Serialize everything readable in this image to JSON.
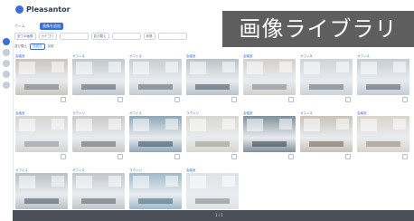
{
  "app": {
    "logo_text": "Pleasantor"
  },
  "banner": {
    "text": "画像ライブラリ"
  },
  "header": {
    "crumb": "ホーム",
    "primary_button": "画像を追加"
  },
  "filters": {
    "chips": [
      "全ての画像",
      "カテゴリ",
      "並び替え",
      "状態"
    ]
  },
  "sort": {
    "label": "並び替え",
    "active": "作成日",
    "other": "名前"
  },
  "images": [
    {
      "title": "会議室",
      "tone": "#c9c4bd",
      "accent": "#6c7076"
    },
    {
      "title": "オフィス",
      "tone": "#bfc6cc",
      "accent": "#4e5a66"
    },
    {
      "title": "オフィス",
      "tone": "#c6ccd1",
      "accent": "#55606b"
    },
    {
      "title": "会議室",
      "tone": "#b9c2c9",
      "accent": "#3f4c58"
    },
    {
      "title": "会議室",
      "tone": "#d3d0cc",
      "accent": "#7b7f86"
    },
    {
      "title": "オフィス",
      "tone": "#cdd3d8",
      "accent": "#5d6873"
    },
    {
      "title": "オフィス",
      "tone": "#c4ccd4",
      "accent": "#4a5663"
    },
    {
      "title": "会議室",
      "tone": "#d5d5d3",
      "accent": "#8a8e94"
    },
    {
      "title": "ラウンジ",
      "tone": "#c9c9c6",
      "accent": "#5f5f5f"
    },
    {
      "title": "オフィス",
      "tone": "#8fa7b6",
      "accent": "#2f4a5e"
    },
    {
      "title": "ラウンジ",
      "tone": "#d8d6d0",
      "accent": "#9a958a"
    },
    {
      "title": "会議室",
      "tone": "#7f8f9a",
      "accent": "#2e3a45"
    },
    {
      "title": "オフィス",
      "tone": "#c8c2b8",
      "accent": "#6b5f52"
    },
    {
      "title": "会議室",
      "tone": "#d9d4cc",
      "accent": "#8e857a"
    },
    {
      "title": "オフィス",
      "tone": "#b7c0c7",
      "accent": "#414c57"
    },
    {
      "title": "オフィス",
      "tone": "#c2c6cb",
      "accent": "#525b64"
    },
    {
      "title": "ラウンジ",
      "tone": "#9fb9c9",
      "accent": "#3c6278"
    },
    {
      "title": "会議室",
      "tone": "#e0e3e6",
      "accent": "#7a8087"
    }
  ],
  "footer": {
    "indicator": "1 / 1"
  }
}
